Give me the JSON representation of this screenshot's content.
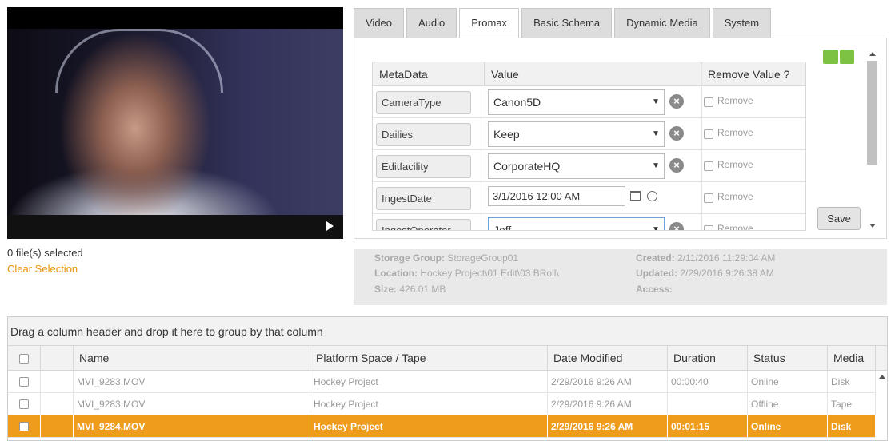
{
  "selection": {
    "count_text": "0 file(s) selected",
    "clear_label": "Clear Selection"
  },
  "tabs": [
    "Video",
    "Audio",
    "Promax",
    "Basic Schema",
    "Dynamic Media",
    "System"
  ],
  "active_tab": "Promax",
  "metadata": {
    "headers": {
      "key": "MetaData",
      "value": "Value",
      "remove": "Remove Value ?"
    },
    "remove_label": "Remove",
    "rows": [
      {
        "key": "CameraType",
        "value": "Canon5D",
        "kind": "select"
      },
      {
        "key": "Dailies",
        "value": "Keep",
        "kind": "select"
      },
      {
        "key": "Editfacility",
        "value": "CorporateHQ",
        "kind": "select"
      },
      {
        "key": "IngestDate",
        "value": "3/1/2016 12:00 AM",
        "kind": "datetime"
      },
      {
        "key": "IngestOperator",
        "value": "Jeff",
        "kind": "select"
      }
    ],
    "save_label": "Save"
  },
  "info": {
    "storage_group_label": "Storage Group:",
    "storage_group": "StorageGroup01",
    "location_label": "Location:",
    "location": "Hockey Project\\01 Edit\\03 BRoll\\",
    "size_label": "Size:",
    "size": "426.01 MB",
    "created_label": "Created:",
    "created": "2/11/2016 11:29:04 AM",
    "updated_label": "Updated:",
    "updated": "2/29/2016 9:26:38 AM",
    "access_label": "Access:",
    "access": ""
  },
  "grid": {
    "group_hint": "Drag a column header and drop it here to group by that column",
    "columns": [
      "Name",
      "Platform Space / Tape",
      "Date Modified",
      "Duration",
      "Status",
      "Media"
    ],
    "rows": [
      {
        "name": "MVI_9283.MOV",
        "platform": "Hockey Project",
        "date": "2/29/2016 9:26 AM",
        "duration": "00:00:40",
        "status": "Online",
        "media": "Disk"
      },
      {
        "name": "MVI_9283.MOV",
        "platform": "Hockey Project",
        "date": "2/29/2016 9:26 AM",
        "duration": "",
        "status": "Offline",
        "media": "Tape"
      },
      {
        "name": "MVI_9284.MOV",
        "platform": "Hockey Project",
        "date": "2/29/2016 9:26 AM",
        "duration": "00:01:15",
        "status": "Online",
        "media": "Disk"
      }
    ],
    "selected_row": 2
  },
  "colors": {
    "accent": "#ef9b1b",
    "link": "#e8950d",
    "toggle": "#7dc242"
  }
}
